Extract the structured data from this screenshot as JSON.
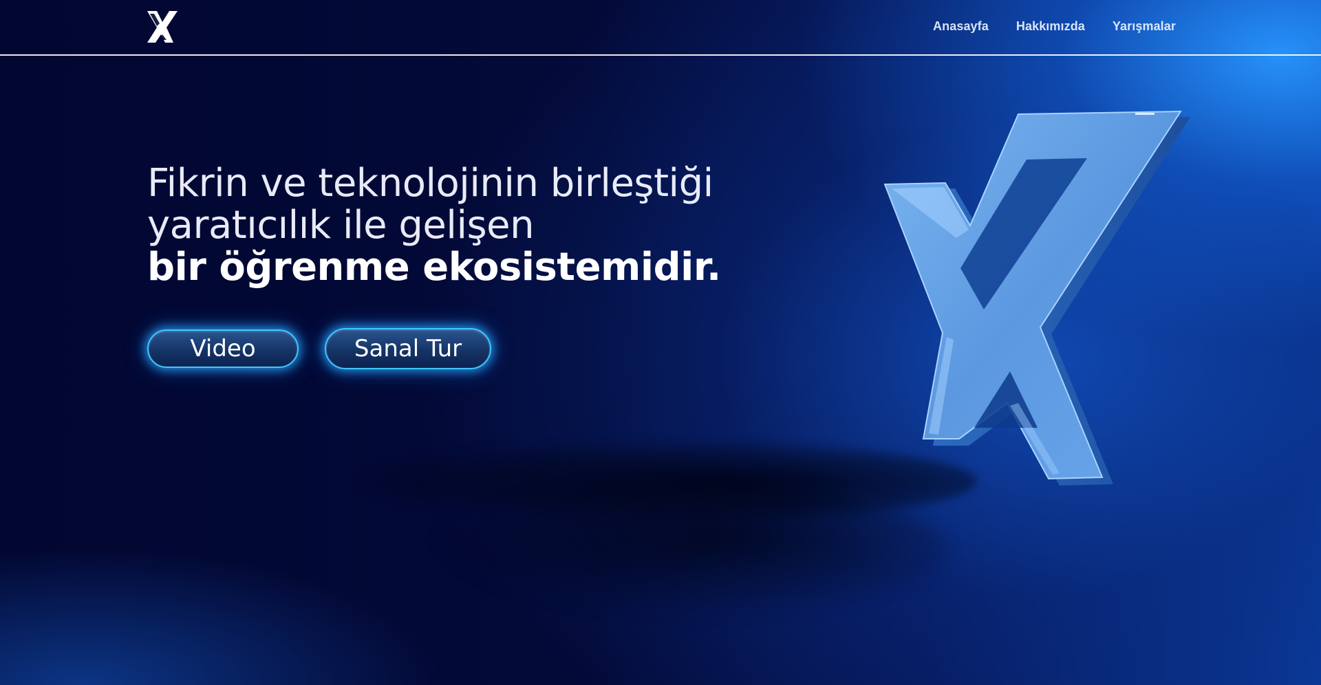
{
  "nav": {
    "logo_icon": "x-mark-logo",
    "items": [
      {
        "label": "Anasayfa"
      },
      {
        "label": "Hakkımızda"
      },
      {
        "label": "Yarışmalar"
      }
    ]
  },
  "hero": {
    "line1": "Fikrin ve teknolojinin birleştiği",
    "line2": "yaratıcılık ile gelişen",
    "line3": "bir öğrenme ekosistemidir."
  },
  "buttons": {
    "video_label": "Video",
    "tour_label": "Sanal Tur"
  },
  "colors": {
    "background_dark": "#020731",
    "accent_blue": "#1e8cff",
    "button_border": "#3ec8ff",
    "logo_3d_blue": "#6aa8ea"
  }
}
